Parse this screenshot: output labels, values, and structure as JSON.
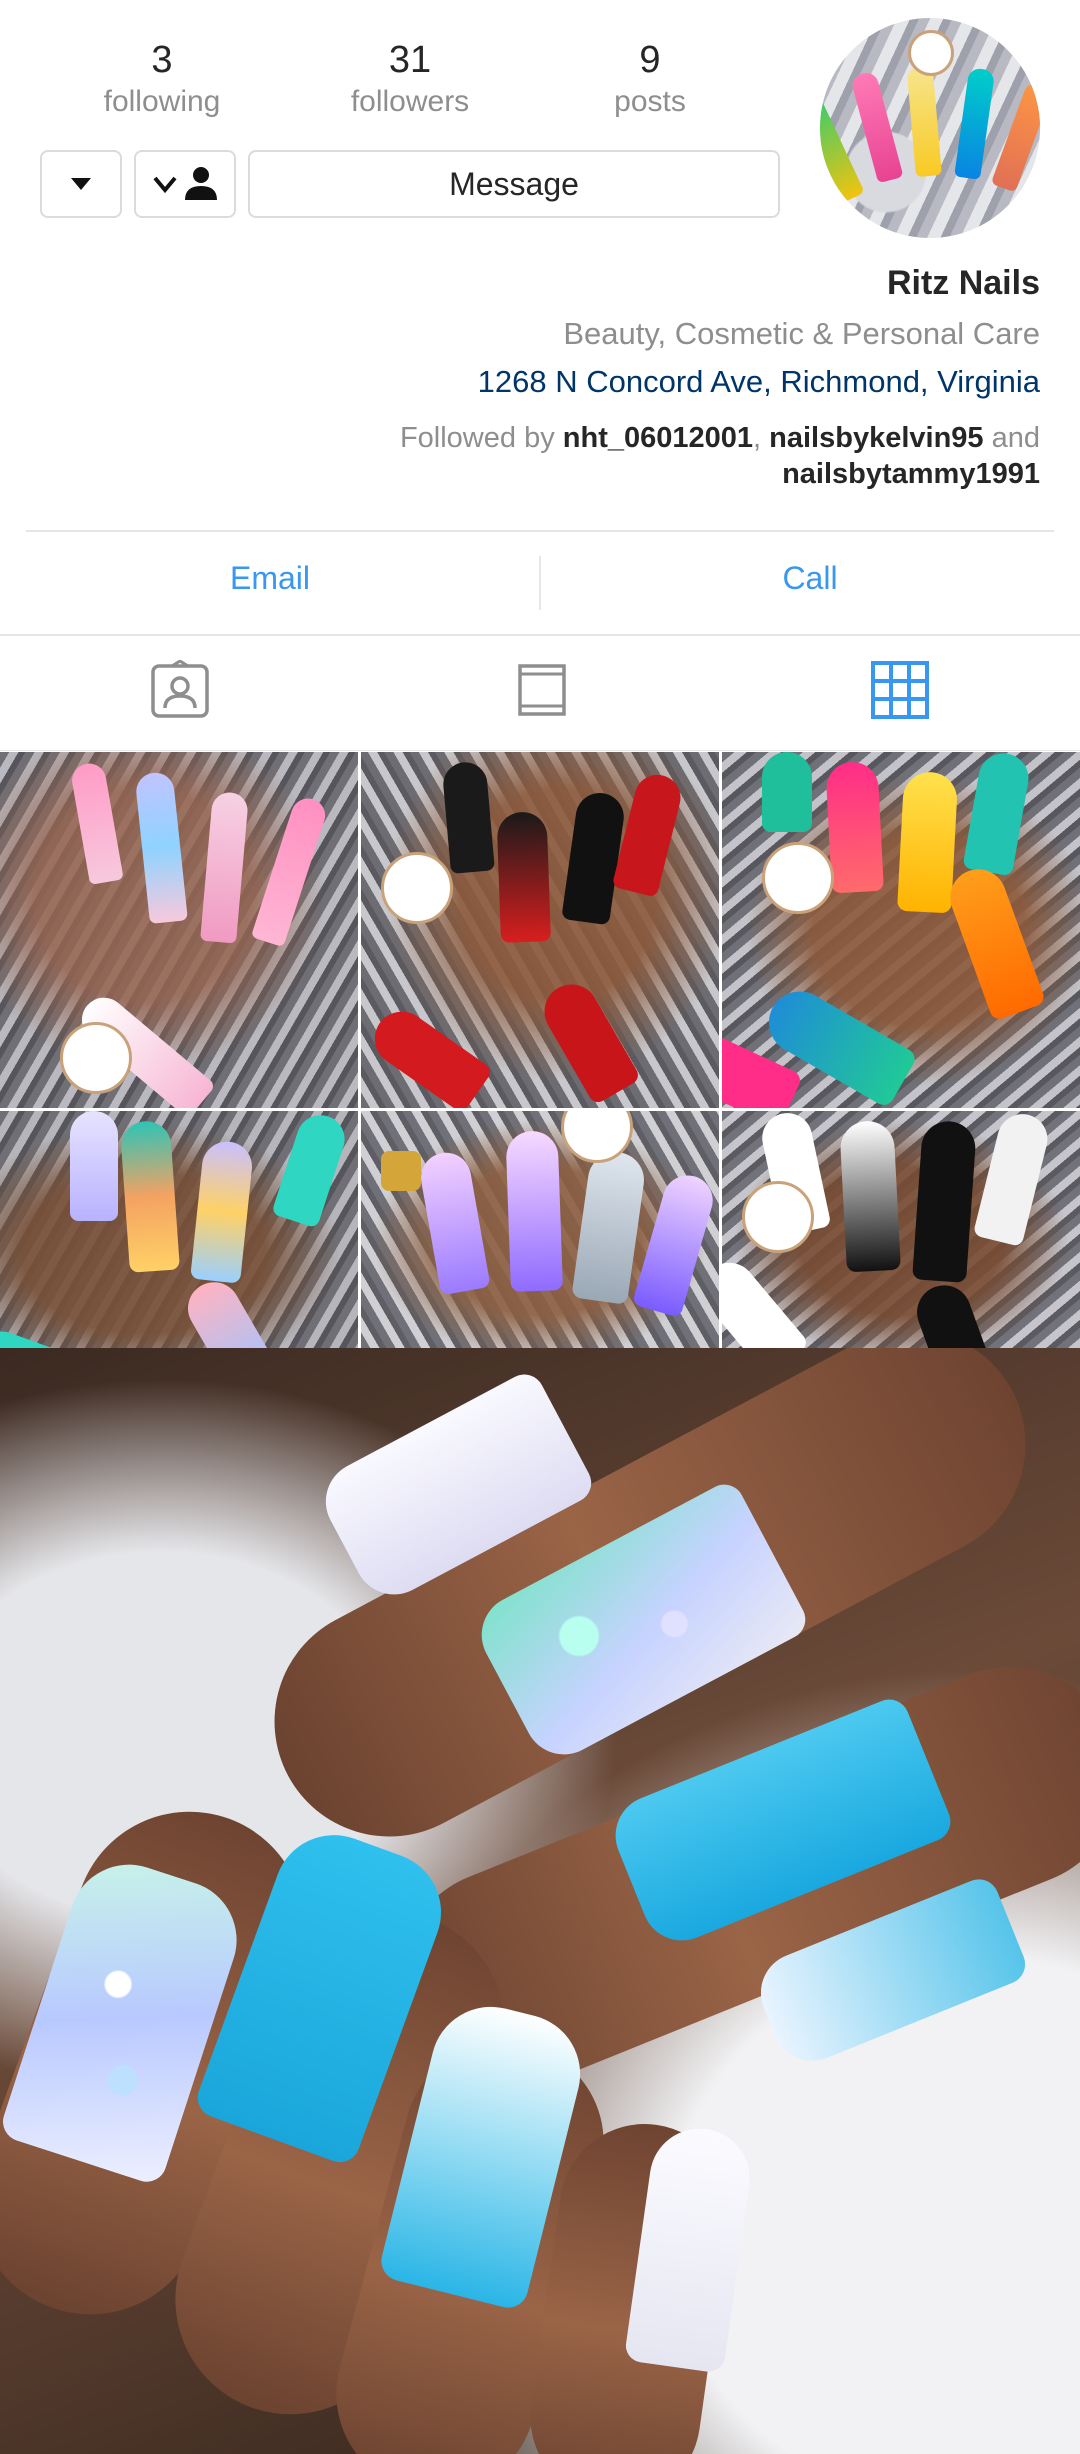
{
  "profile": {
    "name": "Ritz Nails",
    "category": "Beauty, Cosmetic & Personal Care",
    "address": "1268 N Concord Ave, Richmond, Virginia",
    "followed_by_prefix": "Followed by",
    "followed_by_users": [
      "nht_06012001",
      "nailsbykelvin95"
    ],
    "followed_by_and": "and",
    "followed_by_last": "nailsbytammy1991",
    "followed_sep": ","
  },
  "stats": {
    "posts": {
      "count": "9",
      "label": "posts"
    },
    "followers": {
      "count": "31",
      "label": "followers"
    },
    "following": {
      "count": "3",
      "label": "following"
    }
  },
  "actions": {
    "message_label": "Message",
    "follow_icon": "person-check-icon",
    "more_icon": "caret-down-icon"
  },
  "contact": {
    "call_label": "Call",
    "email_label": "Email"
  },
  "tabs": [
    {
      "name": "grid-icon",
      "active": true
    },
    {
      "name": "feed-icon",
      "active": false
    },
    {
      "name": "tagged-icon",
      "active": false
    }
  ],
  "colors": {
    "link_blue": "#3897f0",
    "address_blue": "#003569",
    "secondary_text": "#8e8e8e",
    "primary_text": "#262626"
  }
}
